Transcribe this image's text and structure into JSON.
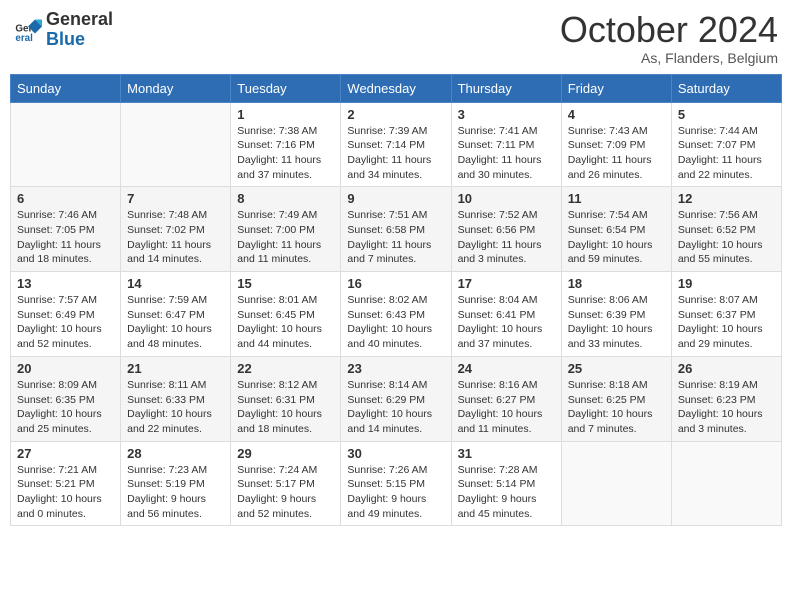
{
  "header": {
    "logo_general": "General",
    "logo_blue": "Blue",
    "month": "October 2024",
    "location": "As, Flanders, Belgium"
  },
  "days_of_week": [
    "Sunday",
    "Monday",
    "Tuesday",
    "Wednesday",
    "Thursday",
    "Friday",
    "Saturday"
  ],
  "weeks": [
    [
      {
        "day": "",
        "empty": true
      },
      {
        "day": "",
        "empty": true
      },
      {
        "day": "1",
        "sunrise": "7:38 AM",
        "sunset": "7:16 PM",
        "daylight": "11 hours and 37 minutes."
      },
      {
        "day": "2",
        "sunrise": "7:39 AM",
        "sunset": "7:14 PM",
        "daylight": "11 hours and 34 minutes."
      },
      {
        "day": "3",
        "sunrise": "7:41 AM",
        "sunset": "7:11 PM",
        "daylight": "11 hours and 30 minutes."
      },
      {
        "day": "4",
        "sunrise": "7:43 AM",
        "sunset": "7:09 PM",
        "daylight": "11 hours and 26 minutes."
      },
      {
        "day": "5",
        "sunrise": "7:44 AM",
        "sunset": "7:07 PM",
        "daylight": "11 hours and 22 minutes."
      }
    ],
    [
      {
        "day": "6",
        "sunrise": "7:46 AM",
        "sunset": "7:05 PM",
        "daylight": "11 hours and 18 minutes."
      },
      {
        "day": "7",
        "sunrise": "7:48 AM",
        "sunset": "7:02 PM",
        "daylight": "11 hours and 14 minutes."
      },
      {
        "day": "8",
        "sunrise": "7:49 AM",
        "sunset": "7:00 PM",
        "daylight": "11 hours and 11 minutes."
      },
      {
        "day": "9",
        "sunrise": "7:51 AM",
        "sunset": "6:58 PM",
        "daylight": "11 hours and 7 minutes."
      },
      {
        "day": "10",
        "sunrise": "7:52 AM",
        "sunset": "6:56 PM",
        "daylight": "11 hours and 3 minutes."
      },
      {
        "day": "11",
        "sunrise": "7:54 AM",
        "sunset": "6:54 PM",
        "daylight": "10 hours and 59 minutes."
      },
      {
        "day": "12",
        "sunrise": "7:56 AM",
        "sunset": "6:52 PM",
        "daylight": "10 hours and 55 minutes."
      }
    ],
    [
      {
        "day": "13",
        "sunrise": "7:57 AM",
        "sunset": "6:49 PM",
        "daylight": "10 hours and 52 minutes."
      },
      {
        "day": "14",
        "sunrise": "7:59 AM",
        "sunset": "6:47 PM",
        "daylight": "10 hours and 48 minutes."
      },
      {
        "day": "15",
        "sunrise": "8:01 AM",
        "sunset": "6:45 PM",
        "daylight": "10 hours and 44 minutes."
      },
      {
        "day": "16",
        "sunrise": "8:02 AM",
        "sunset": "6:43 PM",
        "daylight": "10 hours and 40 minutes."
      },
      {
        "day": "17",
        "sunrise": "8:04 AM",
        "sunset": "6:41 PM",
        "daylight": "10 hours and 37 minutes."
      },
      {
        "day": "18",
        "sunrise": "8:06 AM",
        "sunset": "6:39 PM",
        "daylight": "10 hours and 33 minutes."
      },
      {
        "day": "19",
        "sunrise": "8:07 AM",
        "sunset": "6:37 PM",
        "daylight": "10 hours and 29 minutes."
      }
    ],
    [
      {
        "day": "20",
        "sunrise": "8:09 AM",
        "sunset": "6:35 PM",
        "daylight": "10 hours and 25 minutes."
      },
      {
        "day": "21",
        "sunrise": "8:11 AM",
        "sunset": "6:33 PM",
        "daylight": "10 hours and 22 minutes."
      },
      {
        "day": "22",
        "sunrise": "8:12 AM",
        "sunset": "6:31 PM",
        "daylight": "10 hours and 18 minutes."
      },
      {
        "day": "23",
        "sunrise": "8:14 AM",
        "sunset": "6:29 PM",
        "daylight": "10 hours and 14 minutes."
      },
      {
        "day": "24",
        "sunrise": "8:16 AM",
        "sunset": "6:27 PM",
        "daylight": "10 hours and 11 minutes."
      },
      {
        "day": "25",
        "sunrise": "8:18 AM",
        "sunset": "6:25 PM",
        "daylight": "10 hours and 7 minutes."
      },
      {
        "day": "26",
        "sunrise": "8:19 AM",
        "sunset": "6:23 PM",
        "daylight": "10 hours and 3 minutes."
      }
    ],
    [
      {
        "day": "27",
        "sunrise": "7:21 AM",
        "sunset": "5:21 PM",
        "daylight": "10 hours and 0 minutes."
      },
      {
        "day": "28",
        "sunrise": "7:23 AM",
        "sunset": "5:19 PM",
        "daylight": "9 hours and 56 minutes."
      },
      {
        "day": "29",
        "sunrise": "7:24 AM",
        "sunset": "5:17 PM",
        "daylight": "9 hours and 52 minutes."
      },
      {
        "day": "30",
        "sunrise": "7:26 AM",
        "sunset": "5:15 PM",
        "daylight": "9 hours and 49 minutes."
      },
      {
        "day": "31",
        "sunrise": "7:28 AM",
        "sunset": "5:14 PM",
        "daylight": "9 hours and 45 minutes."
      },
      {
        "day": "",
        "empty": true
      },
      {
        "day": "",
        "empty": true
      }
    ]
  ]
}
